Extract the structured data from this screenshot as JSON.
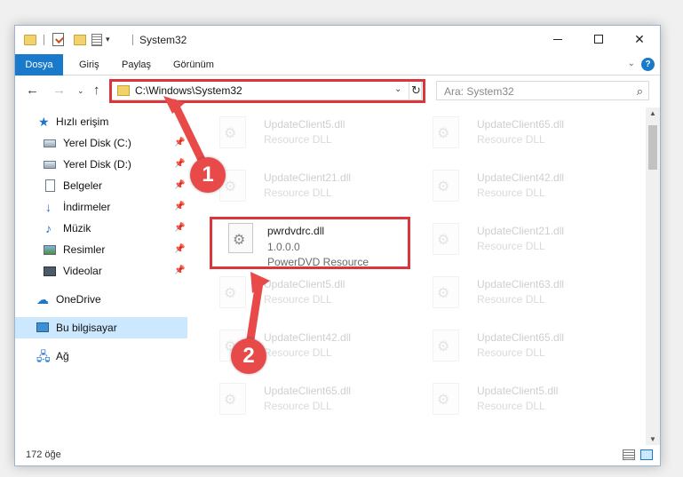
{
  "window": {
    "title": "System32",
    "qa_dropdown": "▾"
  },
  "window_controls": {
    "close": "✕"
  },
  "ribbon": {
    "tabs": [
      "Dosya",
      "Giriş",
      "Paylaş",
      "Görünüm"
    ],
    "collapse": "⌄",
    "help": "?"
  },
  "nav": {
    "back": "←",
    "forward": "→",
    "recent": "⌄",
    "up": "↑",
    "address": "C:\\Windows\\System32",
    "address_dropdown": "⌄",
    "refresh": "↻",
    "search_placeholder": "Ara: System32",
    "search_icon": "⌕"
  },
  "sidebar": {
    "items": [
      {
        "label": "Hızlı erişim",
        "icon": "star-icon",
        "pinned": false
      },
      {
        "label": "Yerel Disk (C:)",
        "icon": "disk-icon",
        "pinned": true
      },
      {
        "label": "Yerel Disk (D:)",
        "icon": "disk-icon",
        "pinned": true
      },
      {
        "label": "Belgeler",
        "icon": "document-icon",
        "pinned": true
      },
      {
        "label": "İndirmeler",
        "icon": "download-icon",
        "pinned": true
      },
      {
        "label": "Müzik",
        "icon": "music-icon",
        "pinned": true
      },
      {
        "label": "Resimler",
        "icon": "pictures-icon",
        "pinned": true
      },
      {
        "label": "Videolar",
        "icon": "videos-icon",
        "pinned": true
      },
      {
        "label": "OneDrive",
        "icon": "cloud-icon",
        "pinned": false
      },
      {
        "label": "Bu bilgisayar",
        "icon": "computer-icon",
        "pinned": false,
        "selected": true
      },
      {
        "label": "Ağ",
        "icon": "network-icon",
        "pinned": false
      }
    ],
    "pin_glyph": "📌"
  },
  "files": {
    "background": [
      {
        "name": "UpdateClient5.dll",
        "desc": "Resource DLL"
      },
      {
        "name": "UpdateClient65.dll",
        "desc": "Resource DLL"
      },
      {
        "name": "UpdateClient21.dll",
        "desc": "Resource DLL"
      },
      {
        "name": "UpdateClient42.dll",
        "desc": "Resource DLL"
      },
      {
        "name": "UpdateClient21.dll",
        "desc": "Resource DLL"
      },
      {
        "name": "UpdateClient5.dll",
        "desc": "Resource DLL"
      },
      {
        "name": "UpdateClient63.dll",
        "desc": "Resource DLL"
      },
      {
        "name": "UpdateClient42.dll",
        "desc": "Resource DLL"
      },
      {
        "name": "UpdateClient65.dll",
        "desc": "Resource DLL"
      },
      {
        "name": "UpdateClient65.dll",
        "desc": "Resource DLL"
      },
      {
        "name": "UpdateClient5.dll",
        "desc": "Resource DLL"
      }
    ],
    "highlighted": {
      "name": "pwrdvdrc.dll",
      "version": "1.0.0.0",
      "desc": "PowerDVD Resource"
    }
  },
  "status": {
    "item_count": "172 öğe"
  },
  "scroll": {
    "up": "▲",
    "down": "▼"
  },
  "annotations": {
    "step1": "1",
    "step2": "2",
    "color": "#e84a4a"
  }
}
